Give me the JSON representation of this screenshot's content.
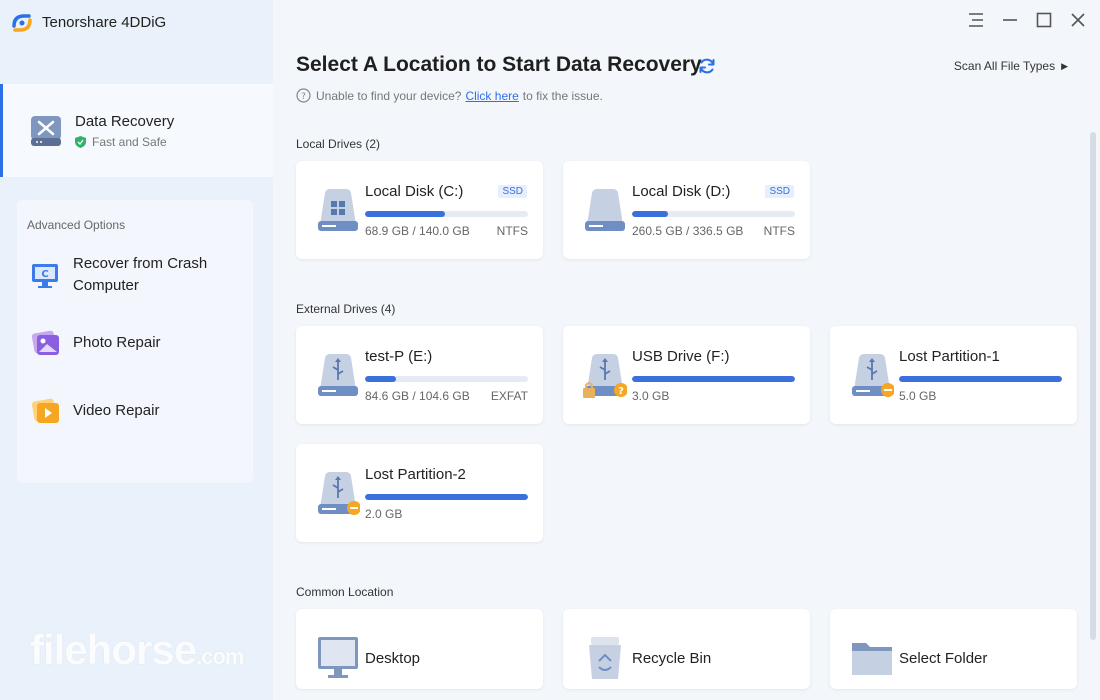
{
  "app": {
    "title": "Tenorshare 4DDiG"
  },
  "sidebar": {
    "active": {
      "title": "Data Recovery",
      "subtitle": "Fast and Safe",
      "icon": "toolbox-icon"
    },
    "advanced_label": "Advanced Options",
    "items": [
      {
        "label": "Recover from Crash Computer",
        "icon": "crash-computer-icon"
      },
      {
        "label": "Photo Repair",
        "icon": "photo-repair-icon"
      },
      {
        "label": "Video Repair",
        "icon": "video-repair-icon"
      }
    ]
  },
  "watermark": {
    "main": "filehorse",
    "suffix": ".com"
  },
  "window": {
    "controls": [
      "menu-icon",
      "minimize-icon",
      "maximize-icon",
      "close-icon"
    ]
  },
  "main": {
    "title": "Select A Location to Start Data Recovery",
    "scan_all": "Scan All File Types",
    "help": {
      "prefix": "Unable to find your device?",
      "link": "Click here",
      "suffix": "to fix the issue."
    },
    "local_label": "Local Drives (2)",
    "external_label": "External Drives (4)",
    "common_label": "Common Location"
  },
  "local_drives": [
    {
      "name": "Local Disk (C:)",
      "badge": "SSD",
      "size": "68.9 GB / 140.0 GB",
      "fs": "NTFS",
      "used_fraction": 0.49
    },
    {
      "name": "Local Disk (D:)",
      "badge": "SSD",
      "size": "260.5 GB / 336.5 GB",
      "fs": "NTFS",
      "used_fraction": 0.22
    }
  ],
  "external_drives": [
    {
      "name": "test-P (E:)",
      "size": "84.6 GB / 104.6 GB",
      "fs": "EXFAT",
      "used_fraction": 0.19,
      "status": ""
    },
    {
      "name": "USB Drive (F:)",
      "size": "3.0 GB",
      "fs": "",
      "used_fraction": 1.0,
      "status": "locked-unknown"
    },
    {
      "name": "Lost Partition-1",
      "size": "5.0 GB",
      "fs": "",
      "used_fraction": 1.0,
      "status": "lost"
    },
    {
      "name": "Lost Partition-2",
      "size": "2.0 GB",
      "fs": "",
      "used_fraction": 1.0,
      "status": "lost"
    }
  ],
  "common_locations": [
    {
      "label": "Desktop",
      "icon": "desktop-icon"
    },
    {
      "label": "Recycle Bin",
      "icon": "recycle-bin-icon"
    },
    {
      "label": "Select Folder",
      "icon": "folder-icon"
    }
  ],
  "colors": {
    "accent": "#2d6fe6",
    "bar": "#3a6fdc",
    "warning": "#f5a623"
  }
}
